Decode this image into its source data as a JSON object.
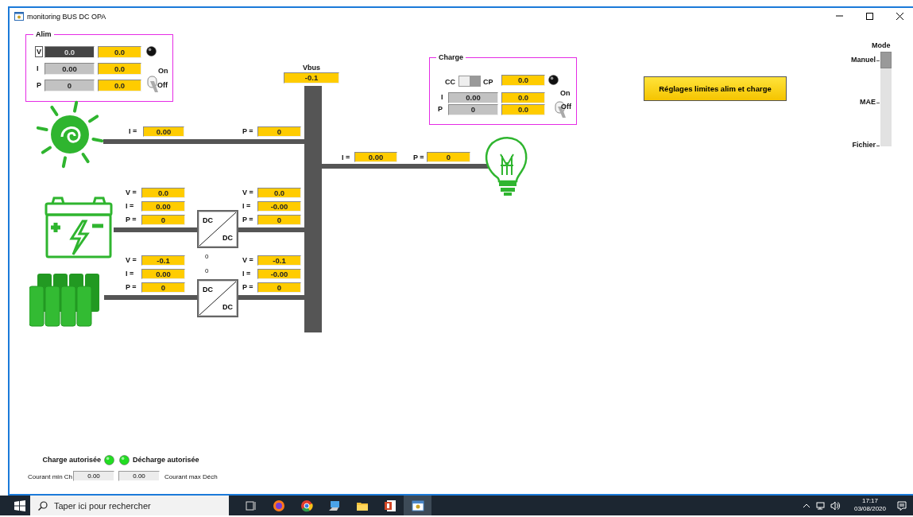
{
  "window": {
    "title": "monitoring BUS DC OPA"
  },
  "alim": {
    "title": "Alim",
    "led_on": false,
    "switch_on": false,
    "on_label": "On",
    "off_label": "Off",
    "rows": [
      {
        "kind": "button",
        "label": "V",
        "measured": "0.0",
        "setpoint": "0.0",
        "focused": true
      },
      {
        "kind": "label",
        "label": "I",
        "measured": "0.00",
        "setpoint": "0.0",
        "focused": false
      },
      {
        "kind": "label",
        "label": "P",
        "measured": "0",
        "setpoint": "0.0",
        "focused": false
      }
    ]
  },
  "vbus": {
    "label": "Vbus",
    "value": "-0.1"
  },
  "charge": {
    "title": "Charge",
    "left_mode": "CC",
    "right_mode": "CP",
    "cp_selected": true,
    "setpoint": "0.0",
    "led_on": false,
    "switch_on": false,
    "on_label": "On",
    "off_label": "Off",
    "rows": [
      {
        "label": "I",
        "measured": "0.00",
        "setpoint": "0.0"
      },
      {
        "label": "P",
        "measured": "0",
        "setpoint": "0.0"
      }
    ]
  },
  "solar": {
    "readings": [
      {
        "label": "I =",
        "value": "0.00"
      },
      {
        "label": "P =",
        "value": "0"
      }
    ]
  },
  "load": {
    "readings": [
      {
        "label": "I =",
        "value": "0.00"
      },
      {
        "label": "P =",
        "value": "0"
      }
    ]
  },
  "battery": {
    "input": [
      {
        "label": "V =",
        "value": "0.0"
      },
      {
        "label": "I =",
        "value": "0.00"
      },
      {
        "label": "P =",
        "value": "0"
      }
    ],
    "output": [
      {
        "label": "V =",
        "value": "0.0"
      },
      {
        "label": "I =",
        "value": "-0.00"
      },
      {
        "label": "P =",
        "value": "0"
      }
    ],
    "converter": {
      "input_label": "DC",
      "output_label": "DC"
    }
  },
  "converter_readouts": [
    "0",
    "0"
  ],
  "supercap": {
    "input": [
      {
        "label": "V =",
        "value": "-0.1"
      },
      {
        "label": "I =",
        "value": "0.00"
      },
      {
        "label": "P =",
        "value": "0"
      }
    ],
    "output": [
      {
        "label": "V =",
        "value": "-0.1"
      },
      {
        "label": "I =",
        "value": "-0.00"
      },
      {
        "label": "P =",
        "value": "0"
      }
    ],
    "converter": {
      "input_label": "DC",
      "output_label": "DC"
    }
  },
  "settings_button": "Réglages limites alim et charge",
  "mode": {
    "title": "Mode",
    "options": [
      {
        "label": "Manuel",
        "selected": true
      },
      {
        "label": "MAE",
        "selected": false
      },
      {
        "label": "Fichier",
        "selected": false
      }
    ]
  },
  "status": {
    "leds": [
      {
        "label": "Charge autorisée",
        "on": true
      },
      {
        "label": "Décharge autorisée",
        "on": true
      }
    ],
    "fields": [
      {
        "label": "Courant min Ch",
        "value": "0.00"
      },
      {
        "label": "Courant max Déch",
        "value": "0.00"
      }
    ]
  },
  "taskbar": {
    "search_placeholder": "Taper ici pour rechercher",
    "apps": [
      {
        "kind": "taskview",
        "active": false
      },
      {
        "kind": "firefox",
        "active": false
      },
      {
        "kind": "chrome",
        "active": false
      },
      {
        "kind": "computer",
        "active": false
      },
      {
        "kind": "folder",
        "active": false
      },
      {
        "kind": "slides",
        "active": false
      },
      {
        "kind": "window",
        "active": true
      }
    ],
    "time": "17:17",
    "date": "03/08/2020"
  }
}
